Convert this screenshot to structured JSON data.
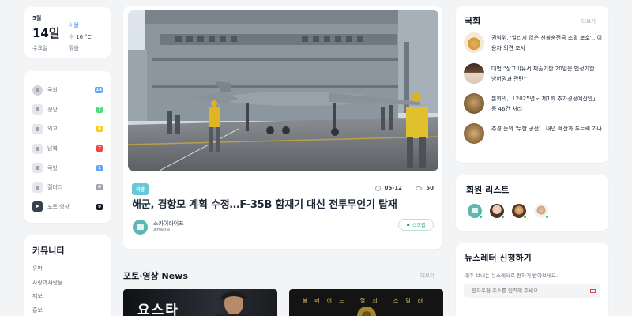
{
  "date_widget": {
    "month": "5월",
    "day": "14일",
    "weekday": "수요일",
    "city": "서울",
    "temp": "16 °C",
    "condition": "맑음"
  },
  "categories": [
    {
      "label": "국회",
      "count": "14",
      "color": "#60a5fa",
      "icon": "globe-icon"
    },
    {
      "label": "정당",
      "count": "7",
      "color": "#4ade80",
      "icon": "document-icon"
    },
    {
      "label": "외교",
      "count": "6",
      "color": "#facc15",
      "icon": "handshake-icon"
    },
    {
      "label": "남북",
      "count": "7",
      "color": "#ef4444",
      "icon": "map-icon"
    },
    {
      "label": "국방",
      "count": "1",
      "color": "#60a5fa",
      "icon": "plane-icon"
    },
    {
      "label": "갤러리",
      "count": "0",
      "color": "#9ca3af",
      "icon": "gallery-icon"
    },
    {
      "label": "포토·영상",
      "count": "9",
      "color": "#111827",
      "icon": "video-icon"
    }
  ],
  "community": {
    "title": "커뮤니티",
    "items": [
      "유머",
      "사랑과사랑들",
      "제보",
      "홍보"
    ]
  },
  "main_article": {
    "tag": "국방",
    "date": "05-12",
    "views": "50",
    "headline": "해군, 경항모 계획 수정…F-35B 함재기 대신 전투무인기 탑재",
    "author": "스카이라이프",
    "role": "ADMIN",
    "scrap": "스크랩"
  },
  "photo_news": {
    "title": "포토·영상 News",
    "more": "더보기",
    "thumb1_text": "요스타",
    "thumb2_text": "불메이드 열쇠 스릴러"
  },
  "gukhoe": {
    "title": "국회",
    "more": "더보기",
    "items": [
      "권익위, '알리지 않은 선불충전금 소멸 보호'…이용자 의견 조사",
      "대법 \"상고이유서 제출기한 20일은 법정기한…방어권과 관련\"",
      "본회의, 「2025년도 제1회 추가경정예산안」 등 46건 처리",
      "추경 논의 '무한 공전'…내년 예산과 투트랙 가나"
    ]
  },
  "members": {
    "title": "회원 리스트"
  },
  "newsletter": {
    "title": "뉴스레터 신청하기",
    "desc": "매주 보내는 뉴스레터로 편하게 받아보세요.",
    "placeholder": "전자우편 주소를 입력해 주세요"
  }
}
